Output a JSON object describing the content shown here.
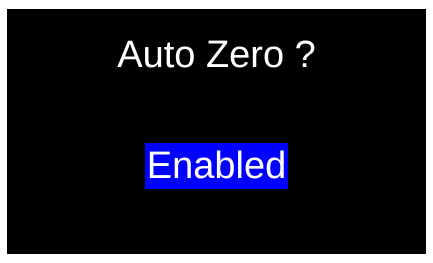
{
  "screen": {
    "title": "Auto Zero ?",
    "selected_value": "Enabled"
  },
  "colors": {
    "background": "#000000",
    "text": "#ffffff",
    "selection_highlight": "#0000ff"
  }
}
